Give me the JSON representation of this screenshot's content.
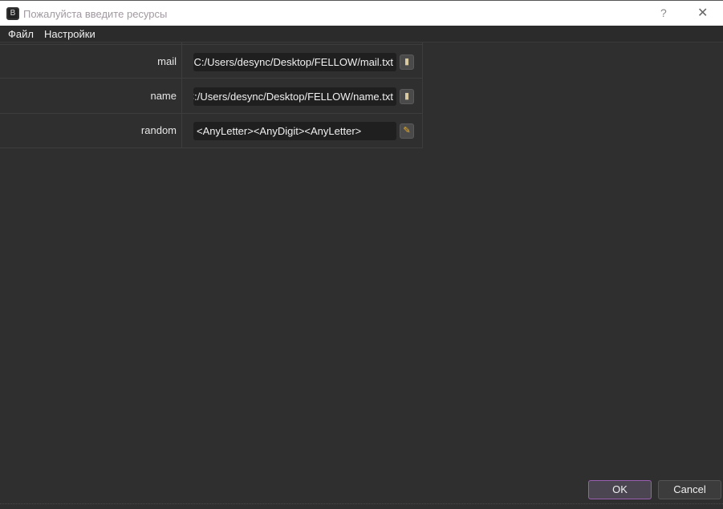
{
  "window": {
    "title": "Пожалуйста введите ресурсы",
    "app_icon": "B",
    "help": "?",
    "close": "✕"
  },
  "menu": [
    "Файл",
    "Настройки"
  ],
  "rows": [
    {
      "label": "mail",
      "value": "C:/Users/desync/Desktop/FELLOW/mail.txt",
      "button_icon": "book-icon"
    },
    {
      "label": "name",
      "value": "C:/Users/desync/Desktop/FELLOW/name.txt",
      "button_icon": "book-icon"
    },
    {
      "label": "random",
      "value": "<AnyLetter><AnyDigit><AnyLetter>",
      "button_icon": "pencil-icon"
    }
  ],
  "buttons": {
    "ok": "OK",
    "cancel": "Cancel"
  }
}
